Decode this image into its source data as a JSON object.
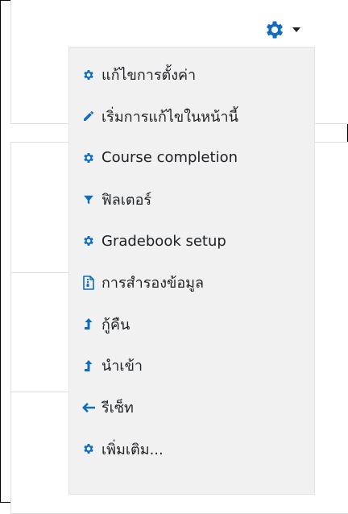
{
  "colors": {
    "icon": "#0f6cbf",
    "text": "#1d2125",
    "menu_bg": "#f1f1f1"
  },
  "trigger": {
    "icon": "gear-icon",
    "caret": "caret-down-icon"
  },
  "menu": {
    "items": [
      {
        "icon": "gear-icon",
        "label": "แก้ไขการตั้งค่า"
      },
      {
        "icon": "pencil-icon",
        "label": "เริ่มการแก้ไขในหน้านี้"
      },
      {
        "icon": "gear-icon",
        "label": "Course completion"
      },
      {
        "icon": "filter-icon",
        "label": "ฟิลเตอร์"
      },
      {
        "icon": "gear-icon",
        "label": "Gradebook setup"
      },
      {
        "icon": "archive-file-icon",
        "label": "การสำรองข้อมูล"
      },
      {
        "icon": "upload-arrow-icon",
        "label": "กู้คืน"
      },
      {
        "icon": "upload-arrow-icon",
        "label": "นำเข้า"
      },
      {
        "icon": "arrow-left-icon",
        "label": "รีเซ็ท"
      },
      {
        "icon": "gear-icon",
        "label": "เพิ่มเติม..."
      }
    ]
  }
}
